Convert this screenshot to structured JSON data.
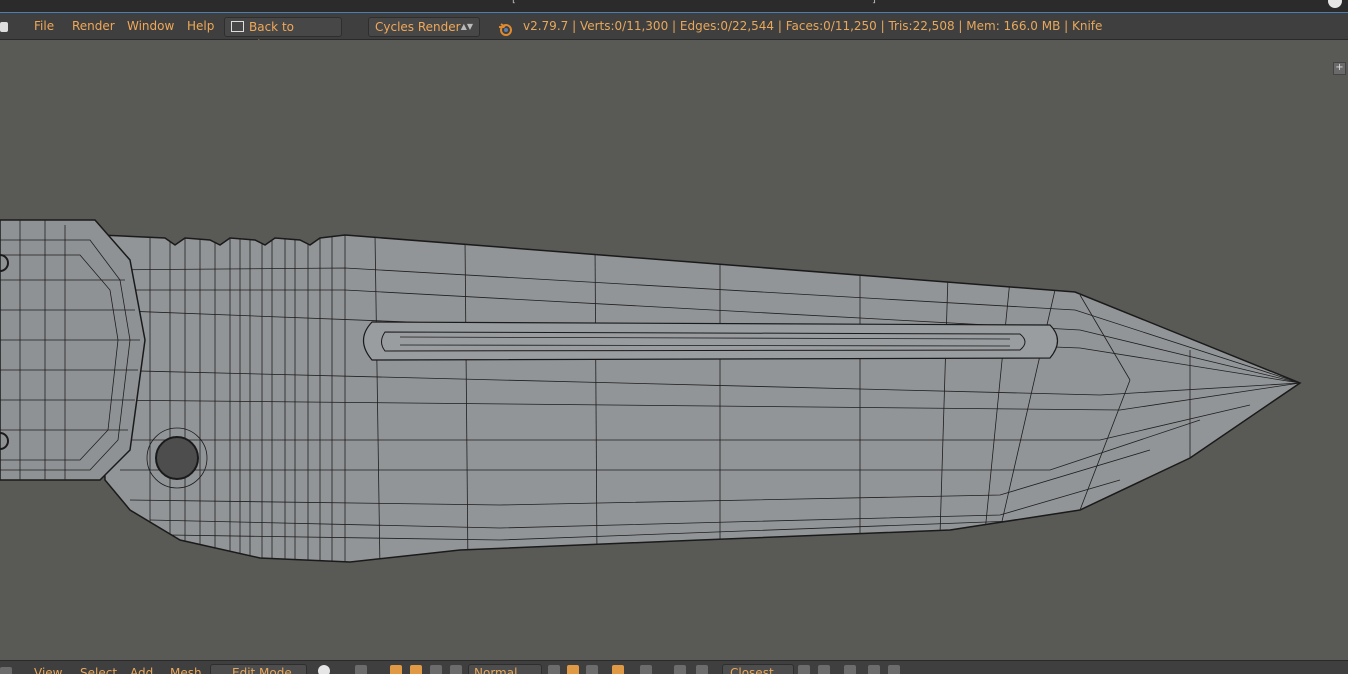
{
  "title_bar": {
    "text_left": "[",
    "text_right": "]"
  },
  "header": {
    "menus": [
      {
        "label": "File"
      },
      {
        "label": "Render"
      },
      {
        "label": "Window"
      },
      {
        "label": "Help"
      }
    ],
    "back_button": "Back to Previous",
    "render_engine": "Cycles Render",
    "stats": "v2.79.7 | Verts:0/11,300 | Edges:0/22,544 | Faces:0/11,250 | Tris:22,508 | Mem: 166.0 MB | Knife",
    "icons": {
      "editor_type": "info-icon",
      "back": "back-to-previous-icon",
      "logo": "blender-logo-icon"
    }
  },
  "viewport": {
    "object_name": "Knife",
    "background_color": "#595955",
    "mesh_fill": "#929598",
    "wire_color": "#1a1a1a"
  },
  "bottom_header": {
    "menus": [
      {
        "label": "View"
      },
      {
        "label": "Select"
      },
      {
        "label": "Add"
      },
      {
        "label": "Mesh"
      }
    ],
    "mode": "Edit Mode",
    "orientation": "Normal",
    "snap_target": "Closest"
  },
  "colors": {
    "accent": "#e8a85c",
    "header_bg": "#3f3f3f"
  }
}
